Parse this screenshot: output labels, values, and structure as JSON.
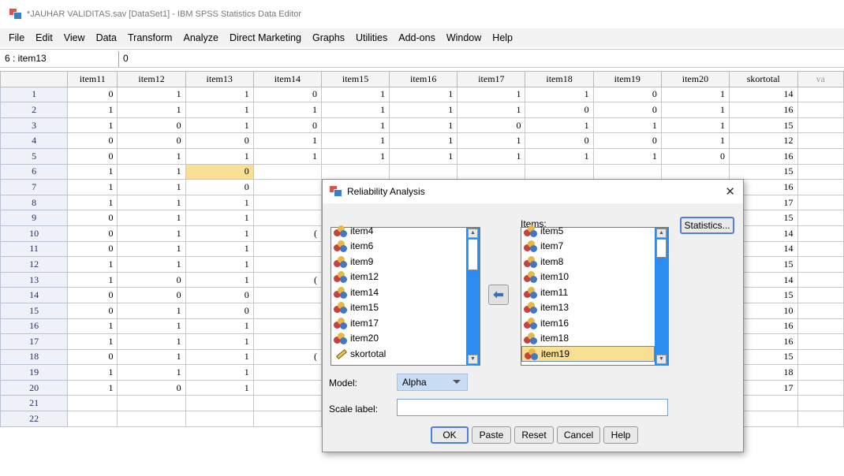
{
  "window": {
    "title": "*JAUHAR VALIDITAS.sav [DataSet1] - IBM SPSS Statistics Data Editor"
  },
  "menu": [
    "File",
    "Edit",
    "View",
    "Data",
    "Transform",
    "Analyze",
    "Direct Marketing",
    "Graphs",
    "Utilities",
    "Add-ons",
    "Window",
    "Help"
  ],
  "cellbar": {
    "ref": "6 : item13",
    "value": "0"
  },
  "grid": {
    "columns": [
      "item11",
      "item12",
      "item13",
      "item14",
      "item15",
      "item16",
      "item17",
      "item18",
      "item19",
      "item20",
      "skortotal",
      "va"
    ],
    "rows": [
      {
        "n": "1",
        "v": [
          "0",
          "1",
          "1",
          "0",
          "1",
          "1",
          "1",
          "1",
          "0",
          "1",
          "14"
        ]
      },
      {
        "n": "2",
        "v": [
          "1",
          "1",
          "1",
          "1",
          "1",
          "1",
          "1",
          "0",
          "0",
          "1",
          "16"
        ]
      },
      {
        "n": "3",
        "v": [
          "1",
          "0",
          "1",
          "0",
          "1",
          "1",
          "0",
          "1",
          "1",
          "1",
          "15"
        ]
      },
      {
        "n": "4",
        "v": [
          "0",
          "0",
          "0",
          "1",
          "1",
          "1",
          "1",
          "0",
          "0",
          "1",
          "12"
        ]
      },
      {
        "n": "5",
        "v": [
          "0",
          "1",
          "1",
          "1",
          "1",
          "1",
          "1",
          "1",
          "1",
          "0",
          "16"
        ]
      },
      {
        "n": "6",
        "v": [
          "1",
          "1",
          "0",
          "",
          "",
          "",
          "",
          "",
          "",
          "",
          "15"
        ]
      },
      {
        "n": "7",
        "v": [
          "1",
          "1",
          "0",
          "",
          "",
          "",
          "",
          "",
          "",
          "",
          "16"
        ]
      },
      {
        "n": "8",
        "v": [
          "1",
          "1",
          "1",
          "",
          "",
          "",
          "",
          "",
          "",
          "",
          "17"
        ]
      },
      {
        "n": "9",
        "v": [
          "0",
          "1",
          "1",
          "",
          "",
          "",
          "",
          "",
          "",
          "",
          "15"
        ]
      },
      {
        "n": "10",
        "v": [
          "0",
          "1",
          "1",
          "(",
          "",
          "",
          "",
          "",
          "",
          "",
          "14"
        ]
      },
      {
        "n": "11",
        "v": [
          "0",
          "1",
          "1",
          "",
          "",
          "",
          "",
          "",
          "",
          "",
          "14"
        ]
      },
      {
        "n": "12",
        "v": [
          "1",
          "1",
          "1",
          "",
          "",
          "",
          "",
          "",
          "",
          "",
          "15"
        ]
      },
      {
        "n": "13",
        "v": [
          "1",
          "0",
          "1",
          "(",
          "",
          "",
          "",
          "",
          "",
          "",
          "14"
        ]
      },
      {
        "n": "14",
        "v": [
          "0",
          "0",
          "0",
          "",
          "",
          "",
          "",
          "",
          "",
          "",
          "15"
        ]
      },
      {
        "n": "15",
        "v": [
          "0",
          "1",
          "0",
          "",
          "",
          "",
          "",
          "",
          "",
          "",
          "10"
        ]
      },
      {
        "n": "16",
        "v": [
          "1",
          "1",
          "1",
          "",
          "",
          "",
          "",
          "",
          "",
          "",
          "16"
        ]
      },
      {
        "n": "17",
        "v": [
          "1",
          "1",
          "1",
          "",
          "",
          "",
          "",
          "",
          "",
          "",
          "16"
        ]
      },
      {
        "n": "18",
        "v": [
          "0",
          "1",
          "1",
          "(",
          "",
          "",
          "",
          "",
          "",
          "",
          "15"
        ]
      },
      {
        "n": "19",
        "v": [
          "1",
          "1",
          "1",
          "",
          "",
          "",
          "",
          "",
          "",
          "",
          "18"
        ]
      },
      {
        "n": "20",
        "v": [
          "1",
          "0",
          "1",
          "",
          "",
          "",
          "",
          "",
          "",
          "",
          "17"
        ]
      },
      {
        "n": "21",
        "v": [
          "",
          "",
          "",
          "",
          "",
          "",
          "",
          "",
          "",
          "",
          ""
        ]
      },
      {
        "n": "22",
        "v": [
          "",
          "",
          "",
          "",
          "",
          "",
          "",
          "",
          "",
          "",
          ""
        ]
      }
    ]
  },
  "dialog": {
    "title": "Reliability Analysis",
    "available": [
      "item4",
      "item6",
      "item9",
      "item12",
      "item14",
      "item15",
      "item17",
      "item20",
      "skortotal"
    ],
    "items_label": "Items:",
    "items": [
      "item5",
      "item7",
      "item8",
      "item10",
      "item11",
      "item13",
      "item16",
      "item18",
      "item19"
    ],
    "statistics": "Statistics...",
    "model_label": "Model:",
    "model_value": "Alpha",
    "scale_label": "Scale label:",
    "scale_value": "",
    "buttons": {
      "ok": "OK",
      "paste": "Paste",
      "reset": "Reset",
      "cancel": "Cancel",
      "help": "Help"
    }
  }
}
